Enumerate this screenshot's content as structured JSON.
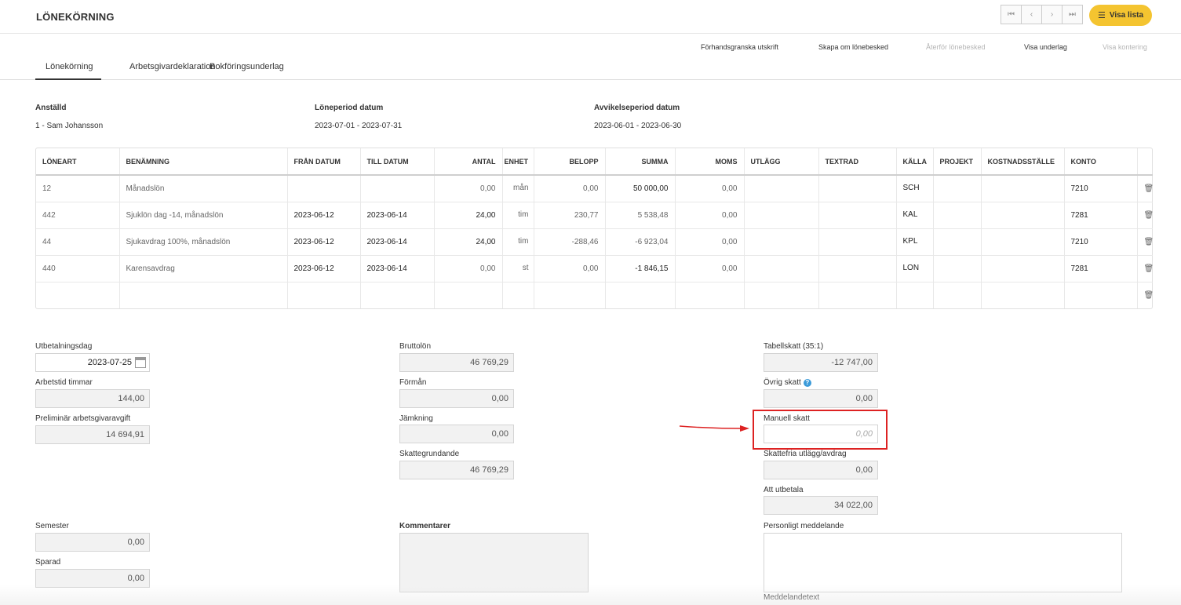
{
  "page": {
    "title": "LÖNEKÖRNING"
  },
  "nav": {
    "first": "⏮",
    "prev": "‹",
    "next": "›",
    "last": "⏭",
    "list_button": "Visa lista"
  },
  "actions": {
    "preview": "Förhandsgranska utskrift",
    "recreate": "Skapa om lönebesked",
    "revert": "Återför lönebesked",
    "show_basis": "Visa underlag",
    "show_posting": "Visa kontering"
  },
  "tabs": [
    "Lönekörning",
    "Arbetsgivardeklaration",
    "Bokföringsunderlag"
  ],
  "info": {
    "employee_label": "Anställd",
    "employee_value": "1 - Sam Johansson",
    "period_label": "Löneperiod datum",
    "period_value": "2023-07-01 - 2023-07-31",
    "deviation_label": "Avvikelseperiod datum",
    "deviation_value": "2023-06-01 - 2023-06-30"
  },
  "table": {
    "headers": [
      "LÖNEART",
      "BENÄMNING",
      "FRÅN DATUM",
      "TILL DATUM",
      "ANTAL",
      "ENHET",
      "BELOPP",
      "SUMMA",
      "MOMS",
      "UTLÄGG",
      "TEXTRAD",
      "KÄLLA",
      "PROJEKT",
      "KOSTNADSSTÄLLE",
      "KONTO"
    ],
    "rows": [
      {
        "loneart": "12",
        "benamning": "Månadslön",
        "fran": "",
        "till": "",
        "antal": "0,00",
        "enhet": "mån",
        "belopp": "0,00",
        "summa": "50 000,00",
        "moms": "0,00",
        "kalla": "SCH",
        "konto": "7210"
      },
      {
        "loneart": "442",
        "benamning": "Sjuklön dag -14, månadslön",
        "fran": "2023-06-12",
        "till": "2023-06-14",
        "antal": "24,00",
        "enhet": "tim",
        "belopp": "230,77",
        "summa": "5 538,48",
        "moms": "0,00",
        "kalla": "KAL",
        "konto": "7281"
      },
      {
        "loneart": "44",
        "benamning": "Sjukavdrag 100%, månadslön",
        "fran": "2023-06-12",
        "till": "2023-06-14",
        "antal": "24,00",
        "enhet": "tim",
        "belopp": "-288,46",
        "summa": "-6 923,04",
        "moms": "0,00",
        "kalla": "KPL",
        "konto": "7210"
      },
      {
        "loneart": "440",
        "benamning": "Karensavdrag",
        "fran": "2023-06-12",
        "till": "2023-06-14",
        "antal": "0,00",
        "enhet": "st",
        "belopp": "0,00",
        "summa": "-1 846,15",
        "moms": "0,00",
        "kalla": "LON",
        "konto": "7281"
      }
    ]
  },
  "fields": {
    "utbetalningsdag_label": "Utbetalningsdag",
    "utbetalningsdag_value": "2023-07-25",
    "arbetstid_label": "Arbetstid timmar",
    "arbetstid_value": "144,00",
    "arbetsgivaravgift_label": "Preliminär arbetsgivaravgift",
    "arbetsgivaravgift_value": "14 694,91",
    "bruttolon_label": "Bruttolön",
    "bruttolon_value": "46 769,29",
    "forman_label": "Förmån",
    "forman_value": "0,00",
    "jamkning_label": "Jämkning",
    "jamkning_value": "0,00",
    "skattegrundande_label": "Skattegrundande",
    "skattegrundande_value": "46 769,29",
    "tabellskatt_label": "Tabellskatt (35:1)",
    "tabellskatt_value": "-12 747,00",
    "ovrig_skatt_label": "Övrig skatt",
    "ovrig_skatt_value": "0,00",
    "manuell_skatt_label": "Manuell skatt",
    "manuell_skatt_placeholder": "0,00",
    "skattefria_label": "Skattefria utlägg/avdrag",
    "skattefria_value": "0,00",
    "att_utbetala_label": "Att utbetala",
    "att_utbetala_value": "34 022,00",
    "semester_label": "Semester",
    "semester_value": "0,00",
    "sparad_label": "Sparad",
    "sparad_value": "0,00",
    "kommentarer_label": "Kommentarer",
    "personligt_label": "Personligt meddelande",
    "meddelandetext_label": "Meddelandetext"
  },
  "colors": {
    "accent": "#f4c430",
    "highlight": "#dd2222"
  },
  "icons": {
    "trash": "trash-icon",
    "calendar": "calendar-icon",
    "help": "help-icon",
    "list": "list-icon"
  }
}
